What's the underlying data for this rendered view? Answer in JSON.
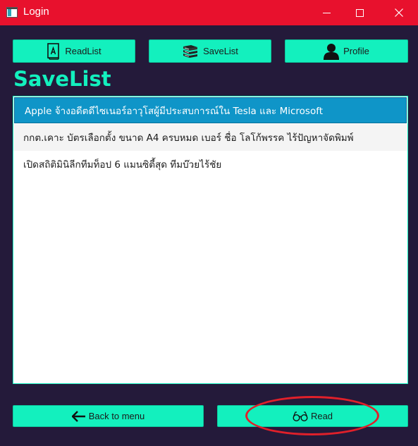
{
  "window": {
    "title": "Login",
    "icon": "app-window-icon",
    "controls": [
      "minimize-icon",
      "maximize-icon",
      "close-icon"
    ],
    "titlebar_color": "#e8112d"
  },
  "nav": {
    "readlist_label": "ReadList",
    "readlist_icon": "book-icon",
    "savelist_label": "SaveList",
    "savelist_icon": "stacked-books-icon",
    "profile_label": "Profile",
    "profile_icon": "person-icon"
  },
  "page": {
    "title": "SaveList"
  },
  "list": {
    "items": [
      {
        "text": "Apple จ้างอดีตดีไซเนอร์อาวุโสผู้มีประสบการณ์ใน Tesla และ Microsoft",
        "selected": true
      },
      {
        "text": "กกต.เคาะ บัตรเลือกตั้ง ขนาด A4 ครบหมด เบอร์ ชื่อ โลโก้พรรค ไร้ปัญหาจัดพิมพ์",
        "selected": false
      },
      {
        "text": "เปิดสถิติมินิลีกทีมท็อป 6 แมนซิตี้สุด ทีมบ๊วยไร้ชัย",
        "selected": false
      }
    ]
  },
  "footer": {
    "back_label": "Back to menu",
    "back_icon": "arrow-left-icon",
    "read_label": "Read",
    "read_icon": "glasses-icon"
  },
  "colors": {
    "accent": "#13f0be",
    "background": "#241a3a",
    "selection": "#0f95c8",
    "annotation": "#e0202a"
  }
}
